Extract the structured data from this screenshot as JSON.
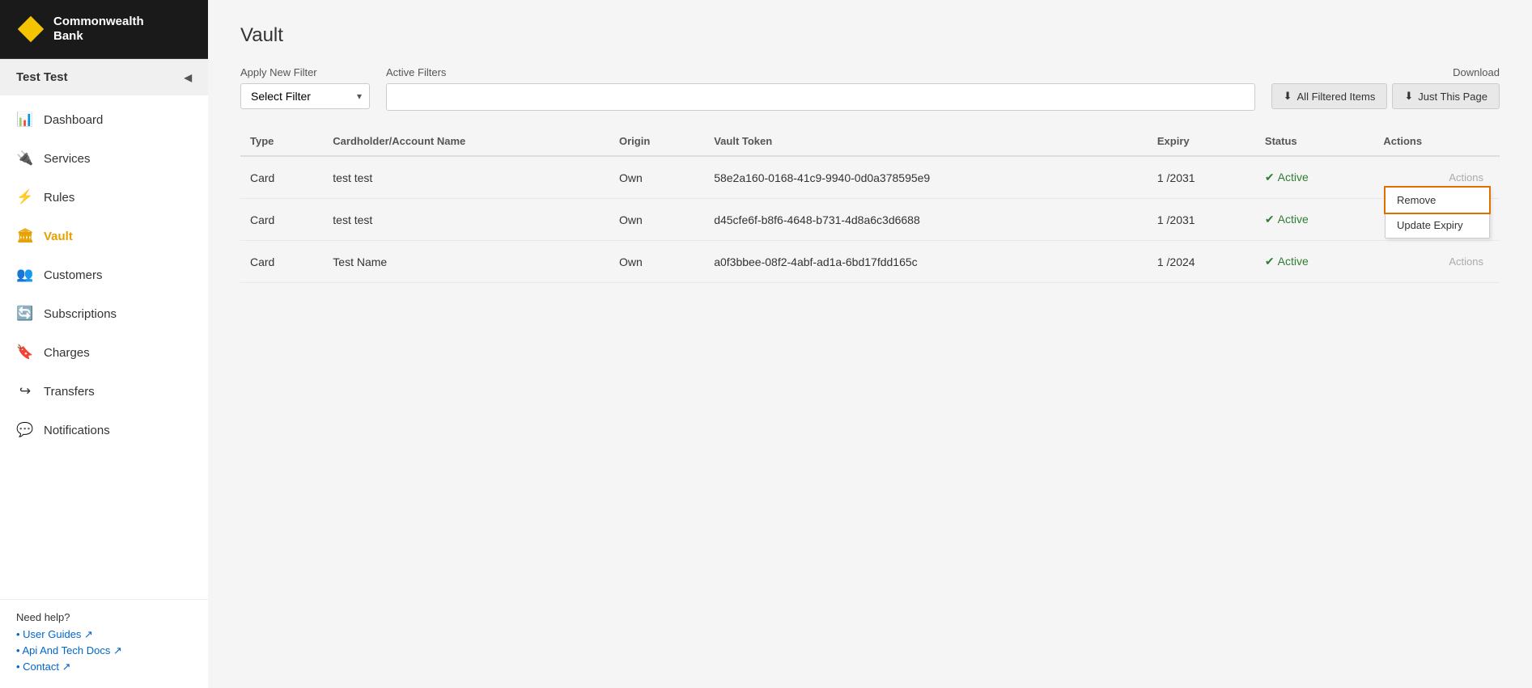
{
  "sidebar": {
    "logo": {
      "text_line1": "Commonwealth",
      "text_line2": "Bank"
    },
    "user": {
      "name": "Test Test",
      "chevron": "◀"
    },
    "nav_items": [
      {
        "id": "dashboard",
        "label": "Dashboard",
        "icon": "📊",
        "active": false
      },
      {
        "id": "services",
        "label": "Services",
        "icon": "🔌",
        "active": false
      },
      {
        "id": "rules",
        "label": "Rules",
        "icon": "⚡",
        "active": false
      },
      {
        "id": "vault",
        "label": "Vault",
        "icon": "🏛",
        "active": true
      },
      {
        "id": "customers",
        "label": "Customers",
        "icon": "👥",
        "active": false
      },
      {
        "id": "subscriptions",
        "label": "Subscriptions",
        "icon": "🔄",
        "active": false
      },
      {
        "id": "charges",
        "label": "Charges",
        "icon": "🔖",
        "active": false
      },
      {
        "id": "transfers",
        "label": "Transfers",
        "icon": "↪",
        "active": false
      },
      {
        "id": "notifications",
        "label": "Notifications",
        "icon": "💬",
        "active": false
      }
    ],
    "footer": {
      "help_title": "Need help?",
      "links": [
        {
          "label": "User Guides ↗",
          "href": "#"
        },
        {
          "label": "Api And Tech Docs ↗",
          "href": "#"
        },
        {
          "label": "Contact ↗",
          "href": "#"
        }
      ]
    }
  },
  "main": {
    "page_title": "Vault",
    "filter": {
      "apply_label": "Apply New Filter",
      "select_placeholder": "Select Filter",
      "active_label": "Active Filters"
    },
    "download": {
      "label": "Download",
      "btn_all": "All Filtered Items",
      "btn_page": "Just This Page",
      "icon": "⬇"
    },
    "table": {
      "columns": [
        "Type",
        "Cardholder/Account Name",
        "Origin",
        "Vault Token",
        "Expiry",
        "Status",
        "Actions"
      ],
      "rows": [
        {
          "type": "Card",
          "name": "test test",
          "origin": "Own",
          "token": "58e2a160-0168-41c9-9940-0d0a378595e9",
          "expiry": "1 /2031",
          "status": "Active",
          "actions": "Actions",
          "show_dropdown": true
        },
        {
          "type": "Card",
          "name": "test test",
          "origin": "Own",
          "token": "d45cfe6f-b8f6-4648-b731-4d8a6c3d6688",
          "expiry": "1 /2031",
          "status": "Active",
          "actions": "Actions",
          "show_dropdown": false
        },
        {
          "type": "Card",
          "name": "Test Name",
          "origin": "Own",
          "token": "a0f3bbee-08f2-4abf-ad1a-6bd17fdd165c",
          "expiry": "1 /2024",
          "status": "Active",
          "actions": "Actions",
          "show_dropdown": false
        }
      ],
      "dropdown_items": [
        "Remove",
        "Update Expiry"
      ]
    }
  }
}
